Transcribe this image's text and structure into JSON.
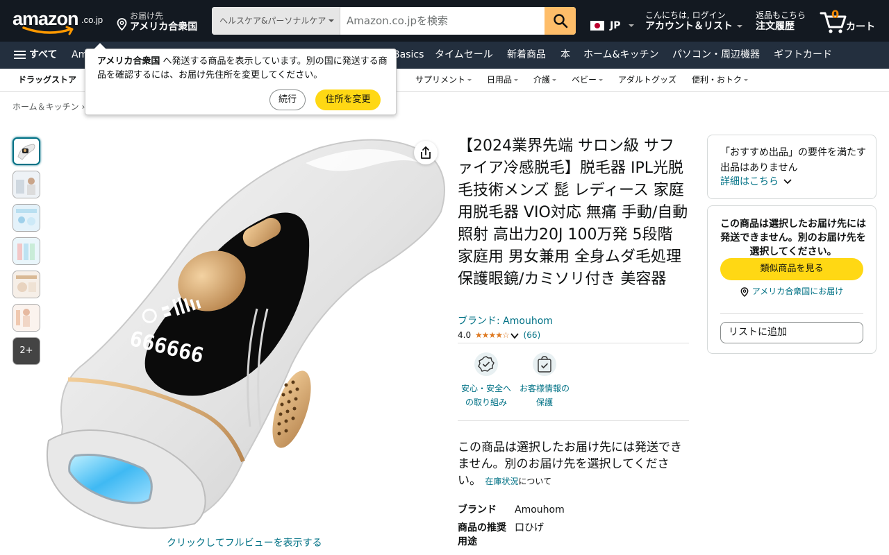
{
  "header": {
    "logo_text": "amazon",
    "logo_tld": ".co.jp",
    "deliver_to_label": "お届け先",
    "deliver_to_country": "アメリカ合衆国",
    "search_category": "ヘルスケア&パーソナルケア",
    "search_placeholder": "Amazon.co.jpを検索",
    "language": "JP",
    "account_greeting": "こんにちは, ログイン",
    "account_label": "アカウント＆リスト",
    "orders_line1": "返品もこちら",
    "orders_line2": "注文履歴",
    "cart_count": "0",
    "cart_label": "カート"
  },
  "main_nav": {
    "all_label": "すべて",
    "items": [
      "Am",
      "Basics",
      "タイムセール",
      "新着商品",
      "本",
      "ホーム&キッチン",
      "パソコン・周辺機器",
      "ギフトカード"
    ]
  },
  "sub_nav": {
    "store": "ドラッグストア",
    "items": [
      "サプリメント",
      "日用品",
      "介護",
      "ベビー",
      "アダルトグッズ",
      "便利・おトク"
    ]
  },
  "breadcrumb": "ホーム＆キッチン ›",
  "popover": {
    "country": "アメリカ合衆国",
    "message": " へ発送する商品を表示しています。別の国に発送する商品を確認するには、お届け先住所を変更してください。",
    "continue_label": "続行",
    "change_label": "住所を変更"
  },
  "gallery": {
    "more_label": "2+",
    "fullview_label": "クリックしてフルビューを表示する",
    "device_counter": "666666"
  },
  "product": {
    "title": "【2024業界先端 サロン級 サファイア冷感脱毛】脱毛器 IPL光脱毛技術メンズ 髭 レディース 家庭用脱毛器 VIO対応 無痛 手動/自動照射 高出力20J 100万発 5段階 家庭用 男女兼用 全身ムダ毛処理 保護眼鏡/カミソリ付き 美容器",
    "brand_link": "ブランド: Amouhom",
    "rating": "4.0",
    "stars": "★★★★☆",
    "review_count": "(66)",
    "badges": [
      {
        "label": "安心・安全への取り組み"
      },
      {
        "label": "お客様情報の保護"
      }
    ],
    "ship_message": "この商品は選択したお届け先には発送できません。別のお届け先を選択してください。",
    "stock_link": "在庫状況",
    "stock_tail": "について",
    "specs": [
      {
        "key": "ブランド",
        "value": "Amouhom"
      },
      {
        "key": "商品の推奨用途",
        "value": "口ひげ"
      }
    ]
  },
  "sidebar": {
    "recommend_text": "「おすすめ出品」の要件を満たす出品はありません",
    "details_link": "詳細はこちら",
    "warning": "この商品は選択したお届け先には発送できません。別のお届け先を選択してください。",
    "similar_button": "類似商品を見る",
    "deliver_link": "アメリカ合衆国にお届け",
    "add_list_button": "リストに追加"
  },
  "colors": {
    "header_bg": "#131921",
    "nav_bg": "#232f3e",
    "accent_yellow": "#ffd814",
    "search_orange": "#febd69",
    "link_teal": "#007185",
    "star_orange": "#de7921"
  }
}
